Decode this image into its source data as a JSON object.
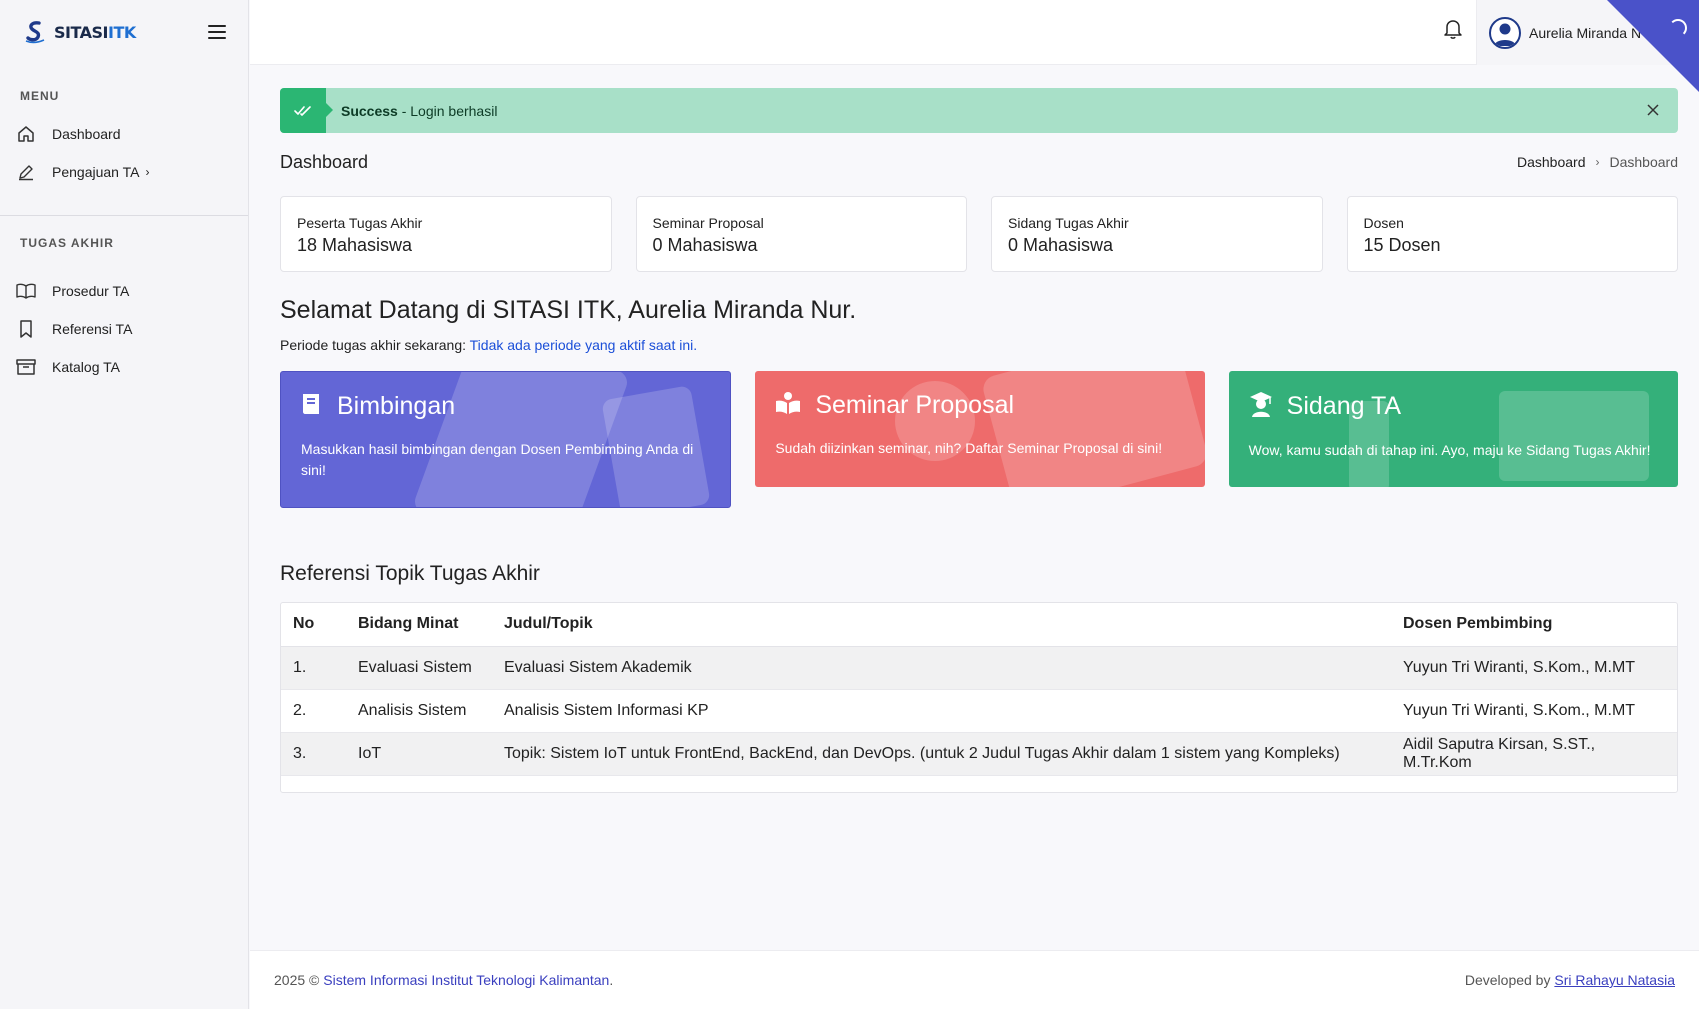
{
  "brand": {
    "logo_text_a": "SITASI",
    "logo_text_b": "ITK"
  },
  "sidebar": {
    "menu_title": "MENU",
    "menu_items": [
      {
        "label": "Dashboard",
        "icon": "home-icon"
      },
      {
        "label": "Pengajuan TA",
        "icon": "pencil-icon"
      }
    ],
    "ta_title": "TUGAS AKHIR",
    "ta_items": [
      {
        "label": "Prosedur TA",
        "icon": "book-open-icon"
      },
      {
        "label": "Referensi TA",
        "icon": "bookmark-icon"
      },
      {
        "label": "Katalog TA",
        "icon": "archive-icon"
      }
    ]
  },
  "topbar": {
    "user_name": "Aurelia Miranda N"
  },
  "alert": {
    "title": "Success",
    "message": " - Login berhasil",
    "status_color": "#2bb673"
  },
  "page": {
    "title": "Dashboard",
    "breadcrumb": [
      "Dashboard",
      "Dashboard"
    ]
  },
  "stats": [
    {
      "label": "Peserta Tugas Akhir",
      "value": "18 Mahasiswa"
    },
    {
      "label": "Seminar Proposal",
      "value": "0 Mahasiswa"
    },
    {
      "label": "Sidang Tugas Akhir",
      "value": "0 Mahasiswa"
    },
    {
      "label": "Dosen",
      "value": "15 Dosen"
    }
  ],
  "welcome": {
    "heading": "Selamat Datang di SITASI ITK, Aurelia Miranda Nur.",
    "period_label": "Periode tugas akhir sekarang: ",
    "period_value": "Tidak ada periode yang aktif saat ini."
  },
  "cards": [
    {
      "title": "Bimbingan",
      "desc": "Masukkan hasil bimbingan dengan Dosen Pembimbing Anda di sini!",
      "color": "#6366d6"
    },
    {
      "title": "Seminar Proposal",
      "desc": "Sudah diizinkan seminar, nih? Daftar Seminar Proposal di sini!",
      "color": "#ee6b6b"
    },
    {
      "title": "Sidang TA",
      "desc": "Wow, kamu sudah di tahap ini. Ayo, maju ke Sidang Tugas Akhir!",
      "color": "#34b07a"
    }
  ],
  "references": {
    "title": "Referensi Topik Tugas Akhir",
    "headers": [
      "No",
      "Bidang Minat",
      "Judul/Topik",
      "Dosen Pembimbing"
    ],
    "rows": [
      [
        "1.",
        "Evaluasi Sistem",
        "Evaluasi Sistem Akademik",
        "Yuyun Tri Wiranti, S.Kom., M.MT"
      ],
      [
        "2.",
        "Analisis Sistem",
        "Analisis Sistem Informasi KP",
        "Yuyun Tri Wiranti, S.Kom., M.MT"
      ],
      [
        "3.",
        "IoT",
        "Topik: Sistem IoT untuk FrontEnd, BackEnd, dan DevOps. (untuk 2 Judul Tugas Akhir dalam 1 sistem yang Kompleks)",
        "Aidil Saputra Kirsan, S.ST., M.Tr.Kom"
      ]
    ]
  },
  "footer": {
    "copy_prefix": "2025 © ",
    "copy_link": "Sistem Informasi Institut Teknologi Kalimantan",
    "copy_suffix": ".",
    "dev_prefix": "Developed by ",
    "dev_link": "Sri Rahayu Natasia"
  }
}
